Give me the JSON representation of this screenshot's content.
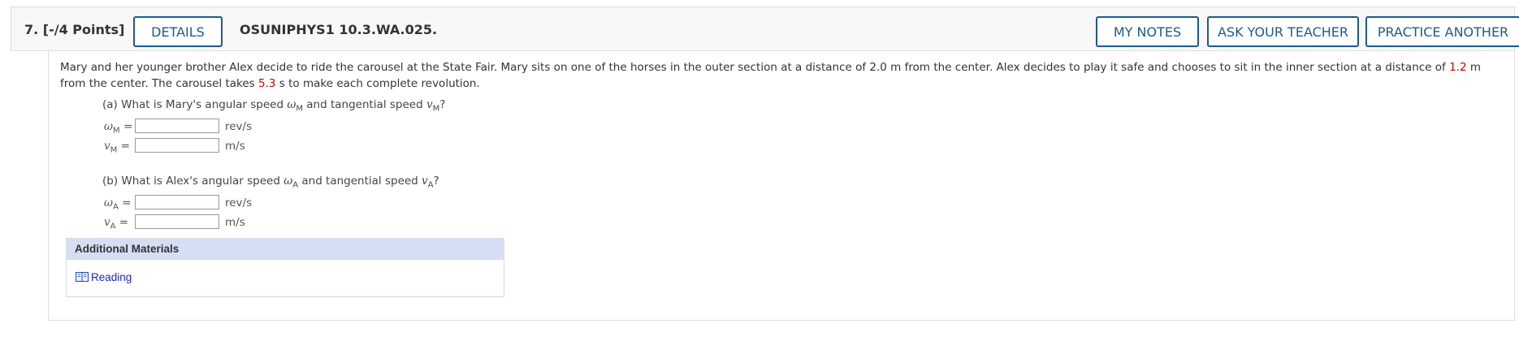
{
  "question": {
    "number": "7.",
    "points": "[-/4 Points]",
    "id": "OSUNIPHYS1 10.3.WA.025."
  },
  "buttons": {
    "details": "DETAILS",
    "my_notes": "MY NOTES",
    "ask_teacher": "ASK YOUR TEACHER",
    "practice": "PRACTICE ANOTHER"
  },
  "prompt": {
    "text1": "Mary and her younger brother Alex decide to ride the carousel at the State Fair. Mary sits on one of the horses in the outer section at a distance of 2.0 m from the center. Alex decides to play it safe and chooses to sit in the inner section at a distance of ",
    "value1": "1.2",
    "text2": " m from the center. The carousel takes ",
    "value2": "5.3",
    "text3": " s to make each complete revolution."
  },
  "part_a": {
    "q_start": "(a) What is Mary's angular speed ",
    "omega": "ω",
    "sub_m": "M",
    "q_mid": " and tangential speed ",
    "v": "v",
    "q_end": "?",
    "rows": [
      {
        "sym": "ω",
        "sub": "M",
        "eq": " =",
        "unit": "rev/s"
      },
      {
        "sym": "v",
        "sub": "M",
        "eq": " =",
        "unit": "m/s"
      }
    ]
  },
  "part_b": {
    "q_start": "(b) What is Alex's angular speed ",
    "omega": "ω",
    "sub_a": "A",
    "q_mid": " and tangential speed ",
    "v": "v",
    "q_end": "?",
    "rows": [
      {
        "sym": "ω",
        "sub": "A",
        "eq": " =",
        "unit": "rev/s"
      },
      {
        "sym": "v",
        "sub": "A",
        "eq": " =",
        "unit": "m/s"
      }
    ]
  },
  "additional": {
    "title": "Additional Materials",
    "link": "Reading",
    "icon": "book-icon"
  },
  "colors": {
    "accent": "#1d5a8e",
    "highlight": "#d00000",
    "materials_header": "#d6def4"
  }
}
